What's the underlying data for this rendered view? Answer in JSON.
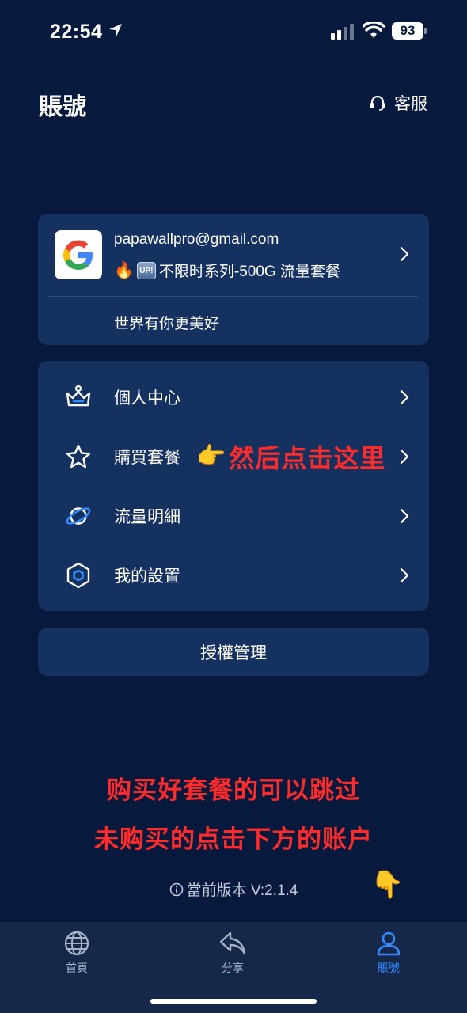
{
  "status_bar": {
    "time": "22:54",
    "battery": "93",
    "icons": [
      "location-arrow-icon",
      "signal-icon",
      "wifi-icon",
      "battery-icon"
    ]
  },
  "header": {
    "title": "賬號",
    "support_label": "客服",
    "support_icon": "headset-icon"
  },
  "account": {
    "email": "papawallpro@gmail.com",
    "fire_emoji": "🔥",
    "up_badge": "UP!",
    "plan": "不限时系列-500G 流量套餐",
    "slogan": "世界有你更美好",
    "avatar_icon": "google-logo-icon"
  },
  "menu": {
    "items": [
      {
        "label": "個人中心",
        "icon": "crown-icon"
      },
      {
        "label": "購買套餐",
        "icon": "star-icon"
      },
      {
        "label": "流量明細",
        "icon": "planet-icon"
      },
      {
        "label": "我的設置",
        "icon": "hexagon-settings-icon"
      }
    ]
  },
  "annotations": {
    "inline_hand": "👉",
    "inline_text": "然后点击这里",
    "line1": "购买好套餐的可以跳过",
    "line2": "未购买的点击下方的账户",
    "hand_down": "👇"
  },
  "auth": {
    "label": "授權管理"
  },
  "version": {
    "text": "當前版本 V:2.1.4",
    "icon": "info-icon"
  },
  "tabs": [
    {
      "label": "首頁",
      "icon": "globe-icon",
      "active": false
    },
    {
      "label": "分享",
      "icon": "share-arrow-icon",
      "active": false
    },
    {
      "label": "賬號",
      "icon": "user-icon",
      "active": true
    }
  ],
  "colors": {
    "background": "#071a3d",
    "card": "#15315f",
    "tab_bar": "#16284a",
    "active_tab": "#2f8bff",
    "annotation_red": "#ff2a2a"
  }
}
